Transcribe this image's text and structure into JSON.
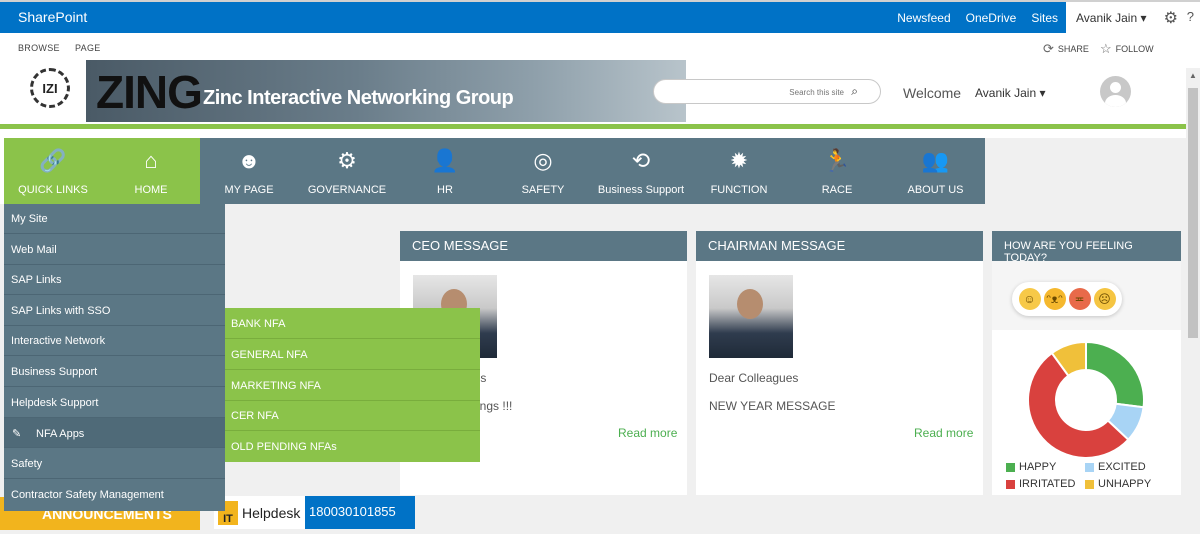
{
  "suitebar": {
    "brand": "SharePoint",
    "links": [
      "Newsfeed",
      "OneDrive",
      "Sites"
    ],
    "user": "Avanik Jain",
    "gear_icon": "gear-icon",
    "help": "?"
  },
  "ribbon": {
    "tabs": [
      "BROWSE",
      "PAGE"
    ],
    "share": "SHARE",
    "follow": "FOLLOW"
  },
  "header": {
    "logo_text": "IZI",
    "brand": "ZING",
    "tagline": "Zinc Interactive Networking Group",
    "search_placeholder": "Search this site",
    "welcome": "Welcome",
    "user": "Avanik Jain"
  },
  "nav": {
    "items": [
      {
        "label": "QUICK LINKS",
        "icon": "link-icon",
        "glyph": "🔗"
      },
      {
        "label": "HOME",
        "icon": "home-icon",
        "glyph": "⌂"
      },
      {
        "label": "MY PAGE",
        "icon": "user-headset-icon",
        "glyph": "☻"
      },
      {
        "label": "GOVERNANCE",
        "icon": "cogs-user-icon",
        "glyph": "⚙"
      },
      {
        "label": "HR",
        "icon": "person-icon",
        "glyph": "👤"
      },
      {
        "label": "SAFETY",
        "icon": "lifebuoy-icon",
        "glyph": "◎"
      },
      {
        "label": "Business Support",
        "icon": "handshake-icon",
        "glyph": "⟲"
      },
      {
        "label": "FUNCTION",
        "icon": "gear-icon",
        "glyph": "✹"
      },
      {
        "label": "RACE",
        "icon": "running-icon",
        "glyph": "🏃"
      },
      {
        "label": "ABOUT US",
        "icon": "group-icon",
        "glyph": "👥"
      }
    ]
  },
  "quick_links": {
    "items": [
      "My Site",
      "Web Mail",
      "SAP Links",
      "SAP Links with SSO",
      "Interactive Network",
      "Business Support",
      "Helpdesk Support",
      "NFA Apps",
      "Safety",
      "Contractor Safety Management"
    ],
    "active_icon_glyph": "✎"
  },
  "nfa_submenu": {
    "items": [
      "BANK NFA",
      "GENERAL NFA",
      "MARKETING NFA",
      "CER NFA",
      "OLD PENDING NFAs"
    ]
  },
  "ceo": {
    "title": "CEO MESSAGE",
    "line1": "ues",
    "line2": "etings !!!",
    "read_more": "Read more"
  },
  "chairman": {
    "title": "CHAIRMAN MESSAGE",
    "greeting": "Dear Colleagues",
    "subject": "NEW YEAR MESSAGE",
    "read_more": "Read more"
  },
  "poll": {
    "title": "HOW ARE YOU FEELING TODAY?",
    "emojis": [
      {
        "icon": "smile-icon",
        "glyph": "☺",
        "color": "#f7c948"
      },
      {
        "icon": "laugh-icon",
        "glyph": "ᵔᴥᵔ",
        "color": "#f5b82e"
      },
      {
        "icon": "angry-icon",
        "glyph": "≖",
        "color": "#e86a4a"
      },
      {
        "icon": "sad-icon",
        "glyph": "☹",
        "color": "#f5c542"
      }
    ]
  },
  "chart_data": {
    "type": "pie",
    "categories": [
      "HAPPY",
      "EXCITED",
      "IRRITATED",
      "UNHAPPY"
    ],
    "values": [
      27,
      10,
      53,
      10
    ],
    "colors": [
      "#4caf50",
      "#a8d4f5",
      "#d9413e",
      "#f0c03a"
    ],
    "donut": true,
    "legend_position": "bottom"
  },
  "bottom": {
    "announcements": "ANNOUNCEMENTS",
    "it": "IT",
    "helpdesk": "Helpdesk",
    "phone": "180030101855"
  }
}
